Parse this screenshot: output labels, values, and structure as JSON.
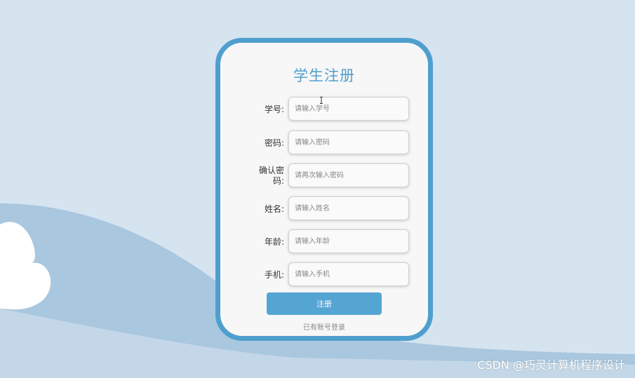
{
  "page": {
    "title": "学生注册",
    "fields": [
      {
        "label": "学号:",
        "placeholder": "请输入学号"
      },
      {
        "label": "密码:",
        "placeholder": "请输入密码"
      },
      {
        "label": "确认密码:",
        "placeholder": "请再次输入密码"
      },
      {
        "label": "姓名:",
        "placeholder": "请输入姓名"
      },
      {
        "label": "年龄:",
        "placeholder": "请输入年龄"
      },
      {
        "label": "手机:",
        "placeholder": "请输入手机"
      }
    ],
    "submit_label": "注册",
    "login_link": "已有账号登录"
  },
  "watermark": "CSDN @巧灵计算机程序设计",
  "colors": {
    "accent": "#4f9fce",
    "button": "#55a5d3",
    "background": "#d6e4f0"
  },
  "icons": {
    "cursor": "text-cursor-icon"
  }
}
